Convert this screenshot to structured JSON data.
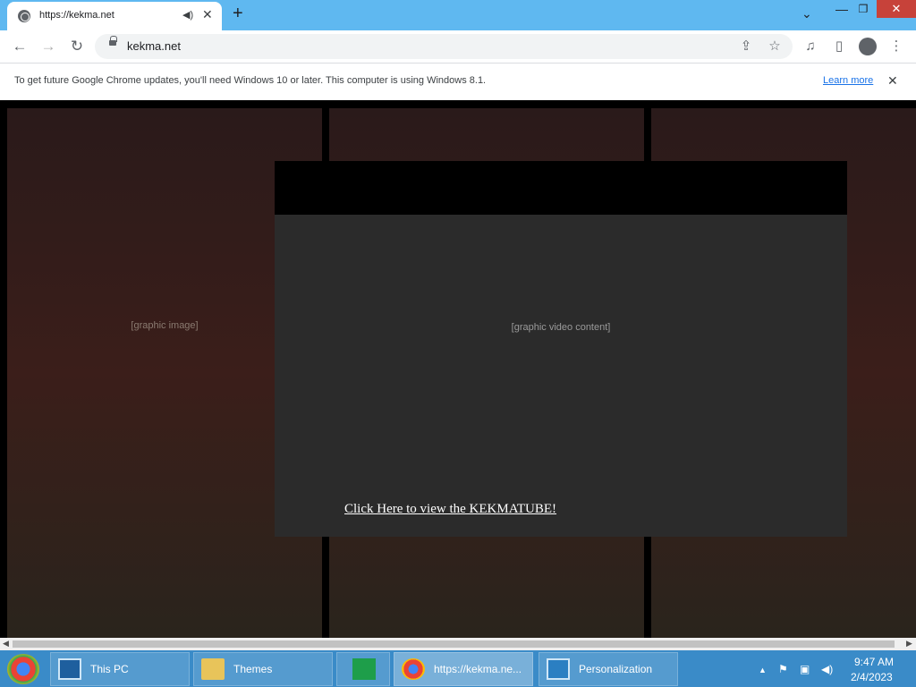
{
  "browser": {
    "tab_title": "https://kekma.net",
    "tab_audio_icon": "speaker-icon",
    "tab_close_glyph": "✕",
    "new_tab_glyph": "+",
    "tab_search_glyph": "⌄",
    "window_min_glyph": "—",
    "window_max_glyph": "❐",
    "window_close_glyph": "✕",
    "url": "kekma.net",
    "back_glyph": "←",
    "forward_glyph": "→",
    "reload_glyph": "↻",
    "share_glyph": "⇪",
    "bookmark_glyph": "☆",
    "media_glyph": "♫",
    "sidepanel_glyph": "▯",
    "menu_glyph": "⋮"
  },
  "infobar": {
    "message": "To get future Google Chrome updates, you'll need Windows 10 or later. This computer is using Windows 8.1.",
    "link": "Learn more",
    "close_glyph": "✕"
  },
  "page": {
    "background_tile_placeholder": "[graphic image]",
    "video_placeholder": "[graphic video content]",
    "link_text": "Click Here to view the KEKMATUBE!"
  },
  "taskbar": {
    "items": [
      {
        "label": "This PC",
        "icon": "computer-icon"
      },
      {
        "label": "Themes",
        "icon": "folder-icon"
      },
      {
        "label": "",
        "icon": "store-icon"
      },
      {
        "label": "https://kekma.ne...",
        "icon": "chrome-icon"
      },
      {
        "label": "Personalization",
        "icon": "personalization-icon"
      }
    ],
    "tray": {
      "chevron": "▲",
      "flag": "⚑",
      "network": "▣",
      "volume": "◀)"
    },
    "time": "9:47 AM",
    "date": "2/4/2023"
  },
  "colors": {
    "titlebar": "#5fb8f0",
    "taskbar": "#3a8bc8",
    "close_button": "#c7423a",
    "link": "#1a73e8"
  }
}
